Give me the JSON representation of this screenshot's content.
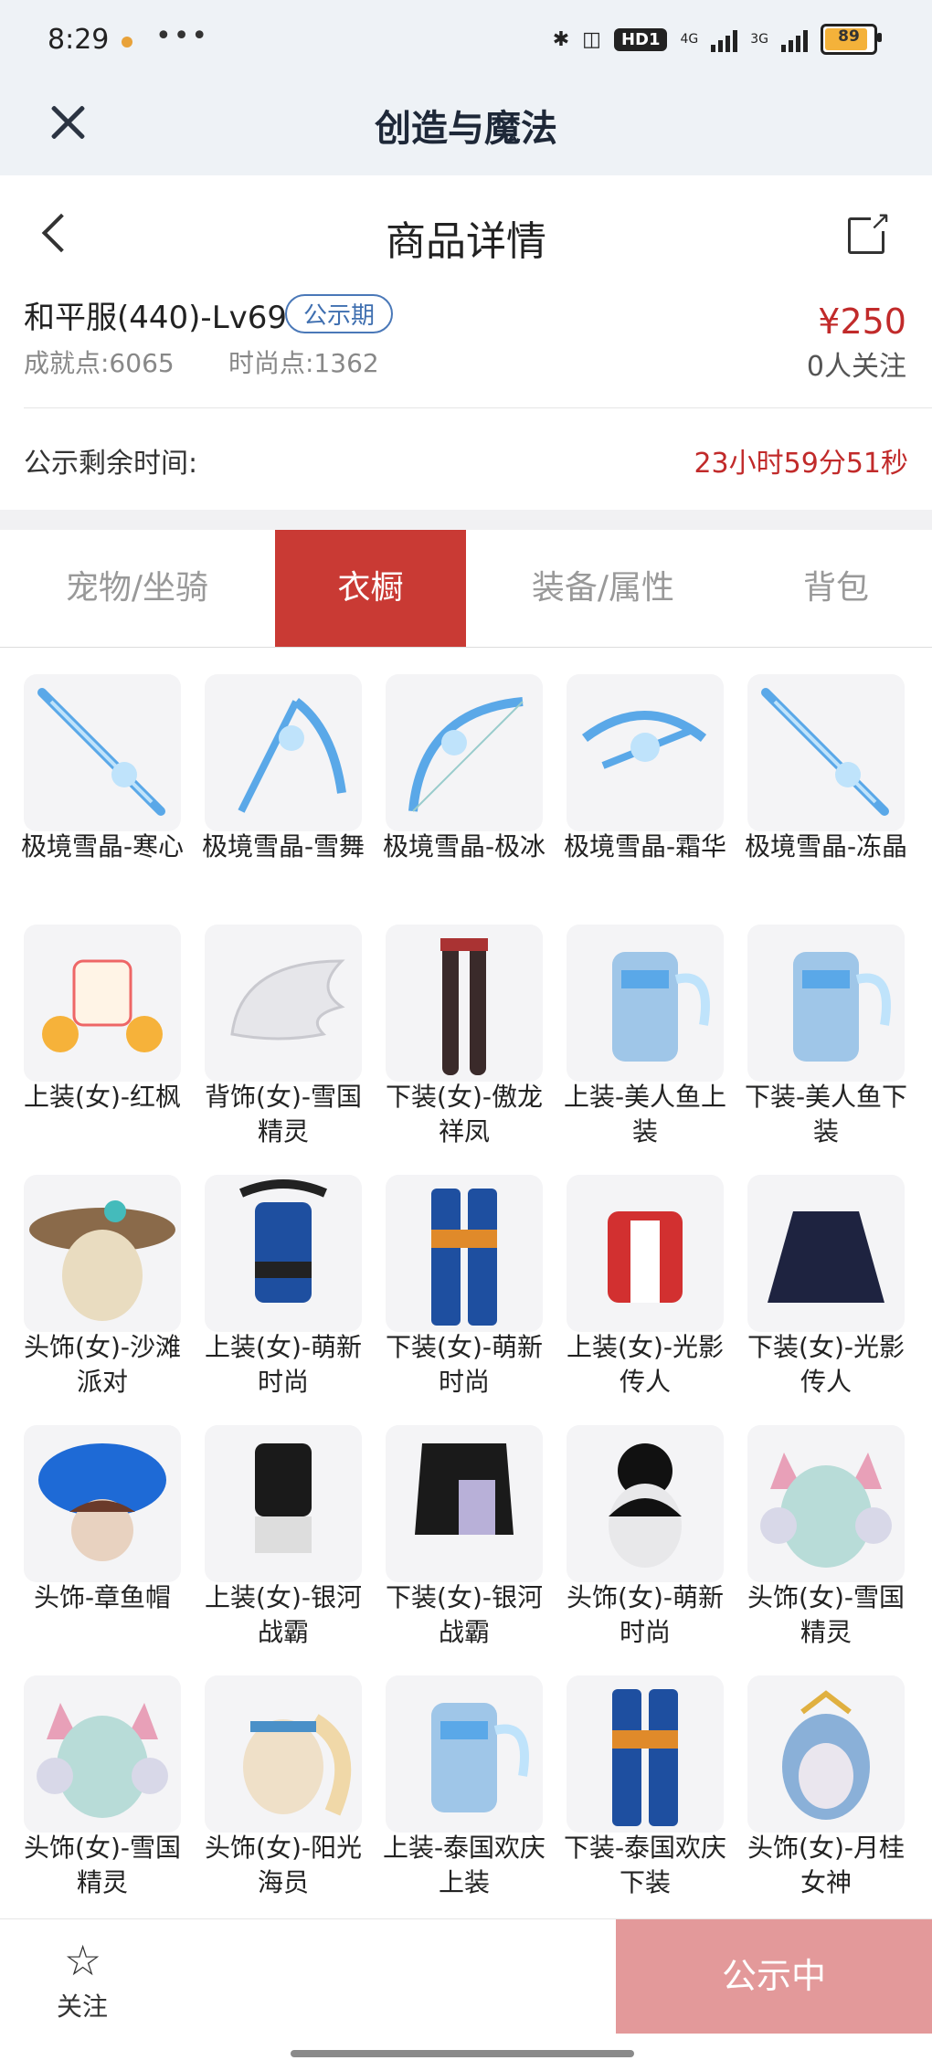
{
  "status": {
    "time": "8:29",
    "more": "•••",
    "hd": "HD1",
    "net1": "4G",
    "net2": "3G",
    "battery": "89"
  },
  "app": {
    "title": "创造与魔法"
  },
  "nav": {
    "title": "商品详情"
  },
  "product": {
    "name": "和平服(440)-Lv69",
    "badge": "公示期",
    "price": "¥250",
    "achievement": "成就点:6065",
    "fashion": "时尚点:1362",
    "followers": "0人关注"
  },
  "remain": {
    "label": "公示剩余时间:",
    "value": "23小时59分51秒"
  },
  "tabs": [
    "宠物/坐骑",
    "衣橱",
    "装备/属性",
    "背包"
  ],
  "active_tab": "衣橱",
  "items": [
    {
      "label": "极境雪晶-寒心",
      "icon": "ice-sword-icon"
    },
    {
      "label": "极境雪晶-雪舞",
      "icon": "ice-scythe-icon"
    },
    {
      "label": "极境雪晶-极冰",
      "icon": "ice-bow-icon"
    },
    {
      "label": "极境雪晶-霜华",
      "icon": "ice-crossbow-icon"
    },
    {
      "label": "极境雪晶-冻晶",
      "icon": "ice-spear-icon"
    },
    {
      "label": "上装(女)-红枫",
      "icon": "top-outfit-icon"
    },
    {
      "label": "背饰(女)-雪国精灵",
      "icon": "wings-icon"
    },
    {
      "label": "下装(女)-傲龙祥凤",
      "icon": "stockings-icon"
    },
    {
      "label": "上装-美人鱼上装",
      "icon": "mermaid-top-icon"
    },
    {
      "label": "下装-美人鱼下装",
      "icon": "mermaid-bottom-icon"
    },
    {
      "label": "头饰(女)-沙滩派对",
      "icon": "sunhat-icon"
    },
    {
      "label": "上装(女)-萌新时尚",
      "icon": "corset-top-icon"
    },
    {
      "label": "下装(女)-萌新时尚",
      "icon": "trousers-icon"
    },
    {
      "label": "上装(女)-光影传人",
      "icon": "jacket-icon"
    },
    {
      "label": "下装(女)-光影传人",
      "icon": "skirt-icon"
    },
    {
      "label": "头饰-章鱼帽",
      "icon": "octopus-hat-icon"
    },
    {
      "label": "上装(女)-银河战霸",
      "icon": "crop-top-icon"
    },
    {
      "label": "下装(女)-银河战霸",
      "icon": "shorts-icon"
    },
    {
      "label": "头饰(女)-萌新时尚",
      "icon": "hair-bun-icon"
    },
    {
      "label": "头饰(女)-雪国精灵",
      "icon": "cat-ear-headphones-icon"
    },
    {
      "label": "头饰(女)-雪国精灵",
      "icon": "cat-ear-headphones-icon"
    },
    {
      "label": "头饰(女)-阳光海员",
      "icon": "ponytail-icon"
    },
    {
      "label": "上装-泰国欢庆上装",
      "icon": "thai-top-icon"
    },
    {
      "label": "下装-泰国欢庆下装",
      "icon": "thai-pants-icon"
    },
    {
      "label": "头饰(女)-月桂女神",
      "icon": "goddess-hair-icon"
    }
  ],
  "bottom": {
    "follow": "关注",
    "action": "公示中"
  },
  "colors": {
    "accent": "#c93a34",
    "price": "#c12a2a",
    "badge": "#3f6fb0",
    "action": "#e3999a"
  }
}
